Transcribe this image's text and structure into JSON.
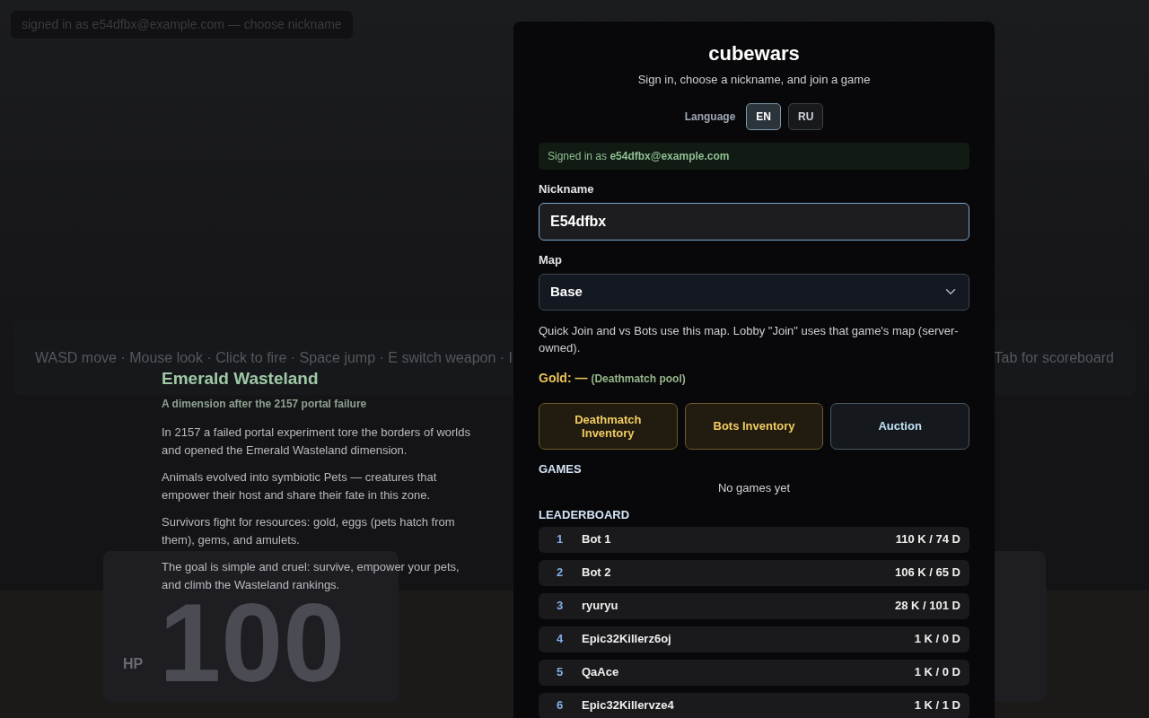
{
  "status_badge": "signed in as e54dfbx@example.com — choose nickname",
  "controls_hint": [
    "WASD move · Mouse look · Click to fire · Space jump · E switch weapon · I",
    "Tab for scoreboard"
  ],
  "lore": {
    "title": "Emerald Wasteland",
    "subtitle": "A dimension after the 2157 portal failure",
    "paragraphs": [
      "In 2157 a failed portal experiment tore the borders of worlds and opened the Emerald Wasteland dimension.",
      "Animals evolved into symbiotic Pets — creatures that empower their host and share their fate in this zone.",
      "Survivors fight for resources: gold, eggs (pets hatch from them), gems, and amulets.",
      "The goal is simple and cruel: survive, empower your pets, and climb the Wasteland rankings."
    ]
  },
  "hud": {
    "hp_label": "HP",
    "hp_value": "100"
  },
  "dialog": {
    "title": "cubewars",
    "subtitle": "Sign in, choose a nickname, and join a game",
    "language_label": "Language",
    "languages": [
      {
        "label": "EN",
        "selected": true
      },
      {
        "label": "RU",
        "selected": false
      }
    ],
    "signed_in": "Signed in as **e54dfbx@example.com**",
    "nickname_label": "Nickname",
    "nickname_value": "E54dfbx",
    "map_label": "Map",
    "map_value": "Base",
    "map_note": "Quick Join and vs Bots use this map. Lobby \"Join\" uses that game's map (server-owned).",
    "gold": "Gold: —",
    "gold_note": "(Deathmatch pool)",
    "actions": [
      {
        "label": "Deathmatch Inventory",
        "kind": "gold"
      },
      {
        "label": "Bots Inventory",
        "kind": "gold"
      },
      {
        "label": "Auction",
        "kind": "plain"
      }
    ],
    "games_heading": "GAMES",
    "games_empty": "No games yet",
    "leaderboard_heading": "LEADERBOARD",
    "leaderboard": [
      {
        "rank": "1",
        "name": "Bot 1",
        "score": "110 K / 74 D"
      },
      {
        "rank": "2",
        "name": "Bot 2",
        "score": "106 K / 65 D"
      },
      {
        "rank": "3",
        "name": "ryuryu",
        "score": "28 K / 101 D"
      },
      {
        "rank": "4",
        "name": "Epic32Killerz6oj",
        "score": "1 K / 0 D"
      },
      {
        "rank": "5",
        "name": "QaAce",
        "score": "1 K / 0 D"
      },
      {
        "rank": "6",
        "name": "Epic32Killervze4",
        "score": "1 K / 1 D"
      }
    ]
  }
}
